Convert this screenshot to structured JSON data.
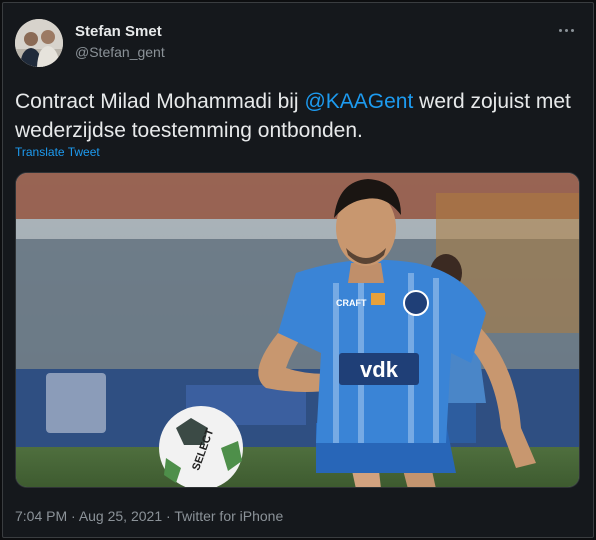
{
  "author": {
    "name": "Stefan Smet",
    "handle": "@Stefan_gent"
  },
  "tweet": {
    "text_before": "Contract Milad Mohammadi bij ",
    "mention": "@KAAGent",
    "text_after": " werd zojuist met wederzijdse toestemming ontbonden.",
    "translate_label": "Translate Tweet"
  },
  "media": {
    "description_icon": "photo",
    "jersey_sponsor": "vdk",
    "jersey_brand": "CRAFT",
    "ball_text": "SELECT"
  },
  "meta": {
    "time": "7:04 PM",
    "separator": " · ",
    "date": "Aug 25, 2021",
    "source": "Twitter for iPhone"
  },
  "colors": {
    "accent": "#1d9bf0",
    "background": "#15181c",
    "text": "#e7e9ea",
    "muted": "#8b9298"
  }
}
